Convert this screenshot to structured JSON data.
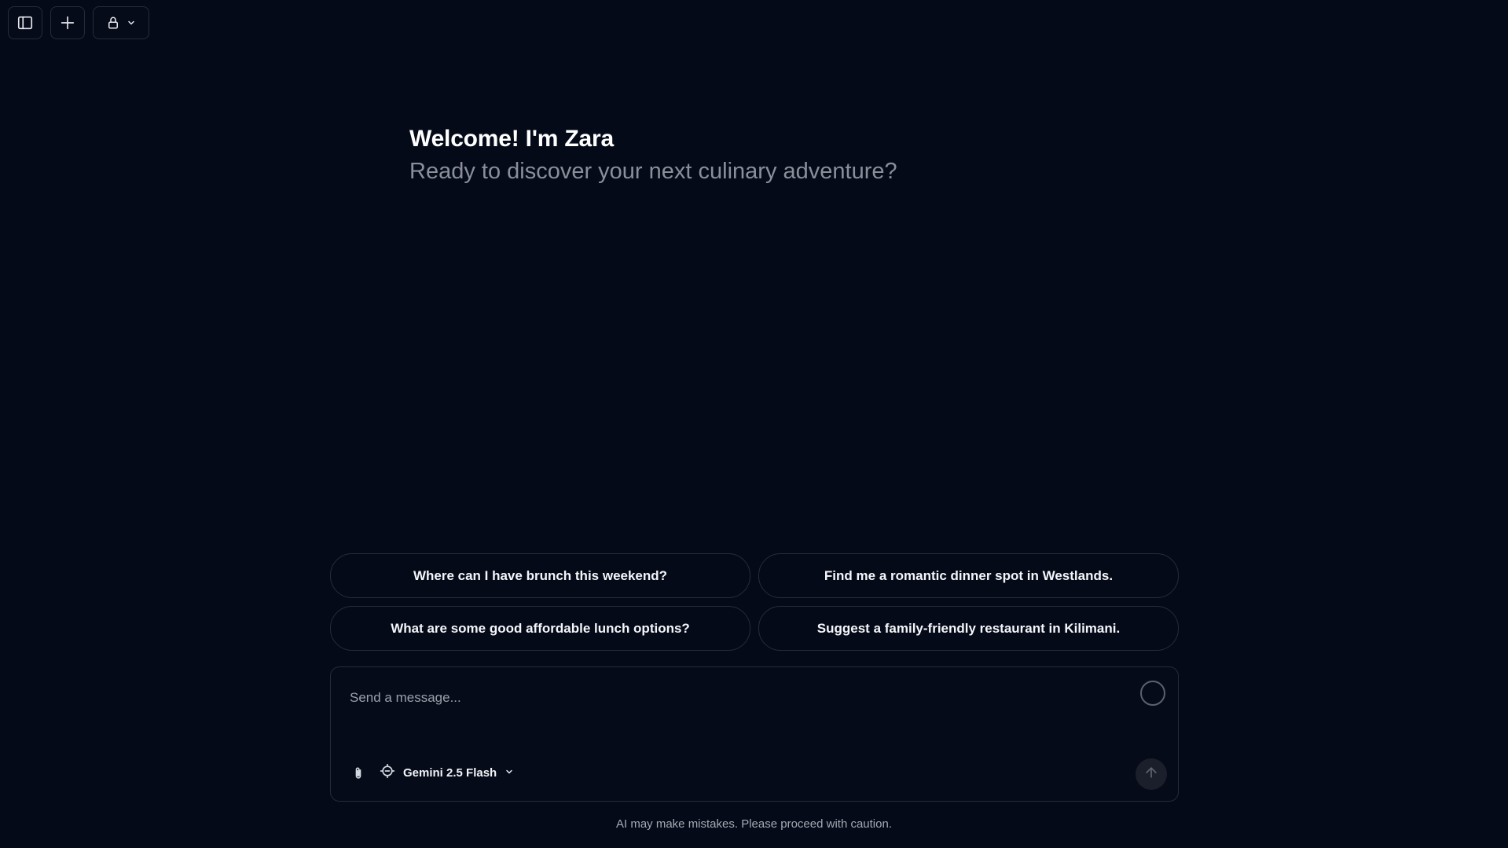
{
  "toolbar": {
    "icons": [
      "sidebar-toggle-icon",
      "plus-icon",
      "lock-icon",
      "chevron-down-icon"
    ]
  },
  "greeting": {
    "title": "Welcome! I'm Zara",
    "subtitle": "Ready to discover your next culinary adventure?"
  },
  "suggestions": [
    {
      "label": "Where can I have brunch this weekend?"
    },
    {
      "label": "Find me a romantic dinner spot in Westlands."
    },
    {
      "label": "What are some good affordable lunch options?"
    },
    {
      "label": "Suggest a family-friendly restaurant in Kilimani."
    }
  ],
  "composer": {
    "placeholder": "Send a message...",
    "value": "",
    "model": "Gemini 2.5 Flash"
  },
  "footer": {
    "disclaimer": "AI may make mistakes. Please proceed with caution."
  },
  "colors": {
    "background": "#050a18",
    "border": "#262c3a",
    "muted_text": "#8a8f9b"
  }
}
